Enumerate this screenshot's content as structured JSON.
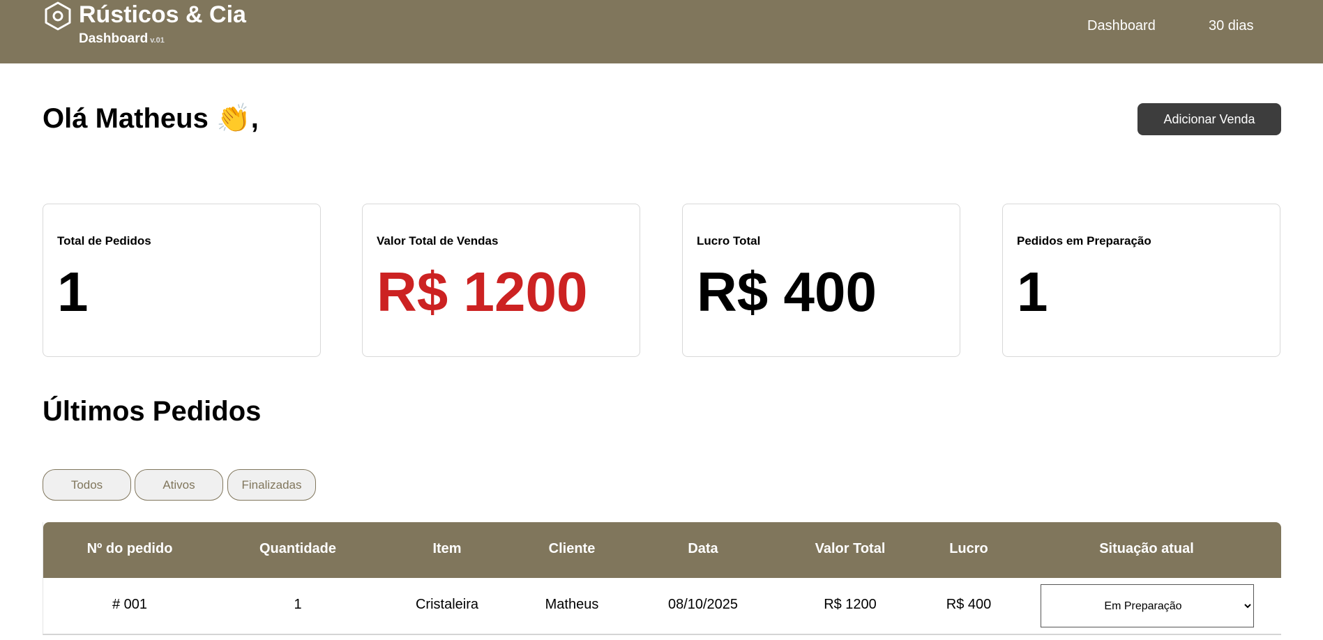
{
  "header": {
    "brand": "Rústicos & Cia",
    "subtitle": "Dashboard",
    "version": "v.01",
    "nav": [
      "Dashboard",
      "30 dias"
    ],
    "color": "#80765c"
  },
  "greeting": "Olá Matheus 👏,",
  "add_sale_label": "Adicionar Venda",
  "cards": [
    {
      "label": "Total de Pedidos",
      "value": "1",
      "color": "#000000"
    },
    {
      "label": "Valor Total de Vendas",
      "value": "R$ 1200",
      "color": "#cc2222"
    },
    {
      "label": "Lucro Total",
      "value": "R$ 400",
      "color": "#000000"
    },
    {
      "label": "Pedidos em Preparação",
      "value": "1",
      "color": "#000000"
    }
  ],
  "orders": {
    "title": "Últimos Pedidos",
    "filters": [
      "Todos",
      "Ativos",
      "Finalizadas"
    ],
    "columns": [
      "Nº do pedido",
      "Quantidade",
      "Item",
      "Cliente",
      "Data",
      "Valor Total",
      "Lucro",
      "Situação atual"
    ],
    "rows": [
      {
        "id": "# 001",
        "qty": "1",
        "item": "Cristaleira",
        "client": "Matheus",
        "date": "08/10/2025",
        "total": "R$ 1200",
        "profit": "R$ 400",
        "status": "Em Preparação"
      }
    ]
  }
}
